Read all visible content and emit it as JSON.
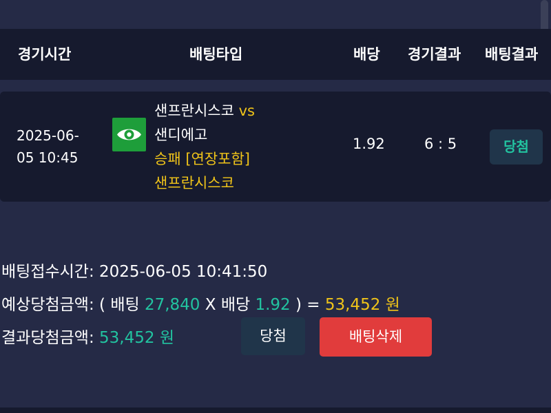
{
  "header": {
    "col_time": "경기시간",
    "col_bet_type": "배팅타입",
    "col_odds": "배당",
    "col_game_result": "경기결과",
    "col_bet_result": "배팅결과"
  },
  "bet": {
    "time_line1": "2025-06-",
    "time_line2": "05 10:45",
    "logo_icon": "eye-icon",
    "home_team": "샌프란시스코",
    "vs": "vs",
    "away_team": "샌디에고",
    "market": "승패 [연장포함]",
    "pick": "샌프란시스코",
    "odds": "1.92",
    "score": "6 : 5",
    "result": "당첨"
  },
  "details": {
    "received_label": "배팅접수시간:",
    "received_value": "2025-06-05 10:41:50",
    "expected_label": "예상당첨금액:",
    "expected_open": "( 배팅",
    "stake": "27,840",
    "times_label": "X 배당",
    "expected_odds": "1.92",
    "expected_close": ") =",
    "expected_amount": "53,452 원",
    "actual_label": "결과당첨금액:",
    "actual_amount": "53,452 원"
  },
  "buttons": {
    "status_label": "당첨",
    "delete_label": "배팅삭제"
  },
  "colors": {
    "background": "#252a46",
    "row": "#161a2e",
    "accent_yellow": "#f0c419",
    "accent_green": "#22c3a0",
    "delete_red": "#e13c3c"
  }
}
